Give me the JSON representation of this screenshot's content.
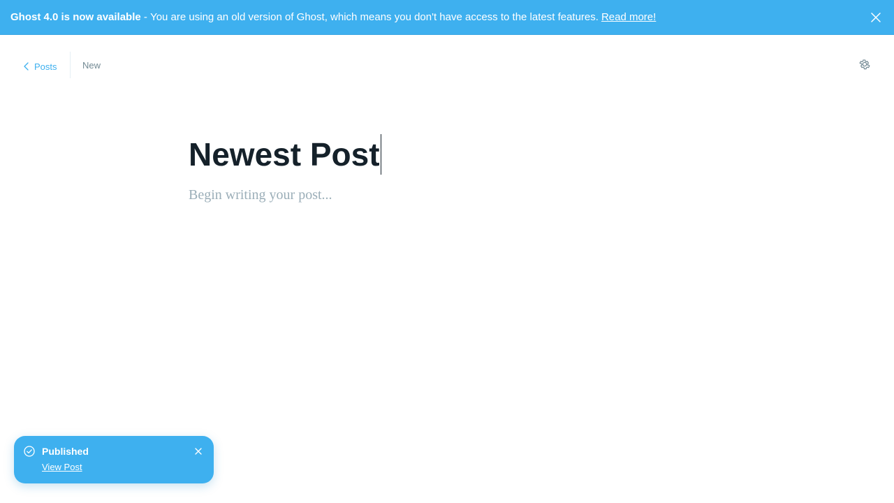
{
  "banner": {
    "strong_text": "Ghost 4.0 is now available",
    "separator": " - ",
    "message": "You are using an old version of Ghost, which means you don't have access to the latest features.",
    "link_text": "Read more!"
  },
  "header": {
    "back_label": "Posts",
    "status": "New"
  },
  "editor": {
    "title": "Newest Post",
    "body_placeholder": "Begin writing your post..."
  },
  "notification": {
    "title": "Published",
    "link_text": "View Post"
  },
  "colors": {
    "accent": "#3eb0ef",
    "text_dark": "#15212a",
    "muted": "#738a94",
    "placeholder": "#9baeb8"
  },
  "icons": {
    "banner_close": "close-icon",
    "back": "chevron-left-icon",
    "settings": "gear-icon",
    "toast_status": "check-circle-icon",
    "toast_close": "close-icon"
  }
}
